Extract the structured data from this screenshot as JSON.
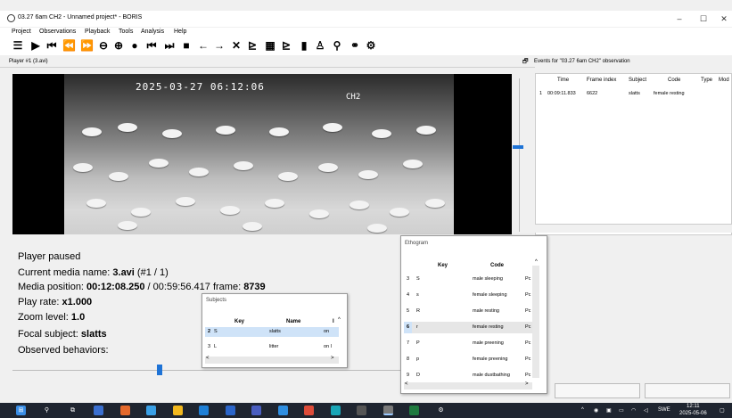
{
  "window": {
    "title": "03.27 6am CH2 - Unnamed project* - BORIS",
    "minimize": "–",
    "maximize": "☐",
    "close": "✕"
  },
  "menu": [
    "Project",
    "Observations",
    "Playback",
    "Tools",
    "Analysis",
    "Help"
  ],
  "toolbar_icons": [
    "list-icon",
    "play-icon",
    "step-back-icon",
    "rewind-icon",
    "fast-forward-icon",
    "minus-circle-icon",
    "plus-circle-icon",
    "record-icon",
    "skip-back-icon",
    "skip-forward-icon",
    "camera-icon",
    "arrow-left-icon",
    "arrow-right-icon",
    "close-icon",
    "bar-chart-icon",
    "grid-icon",
    "line-chart-icon",
    "histogram-icon",
    "person-icon",
    "search-icon",
    "binoculars-icon",
    "settings-icon"
  ],
  "player": {
    "header": "Player #1 (3.avi)",
    "video_timestamp": "2025-03-27 06:12:06",
    "video_camera": "CH2"
  },
  "events": {
    "pin": "🗗",
    "title": "Events for \"03.27 6am CH2\" observation",
    "columns": [
      "Time",
      "Frame index",
      "Subject",
      "Code",
      "Type",
      "Mod"
    ],
    "rows": [
      {
        "num": "1",
        "time": "00:09:11.833",
        "frame": "6622",
        "subject": "slatts",
        "code": "female resting",
        "type": "",
        "mod": ""
      }
    ]
  },
  "info": {
    "status": "Player paused",
    "media_name_label": "Current media name: ",
    "media_name_value": "3.avi",
    "media_name_suffix": " (#1 / 1)",
    "position_label": "Media position: ",
    "position_value": "00:12:08.250",
    "position_mid": " / 00:59:56.417 frame: ",
    "frame_value": "8739",
    "rate_label": "Play rate: ",
    "rate_value": "x1.000",
    "zoom_label": "Zoom level: ",
    "zoom_value": "1.0",
    "focal_label": "Focal subject: ",
    "focal_value": "slatts",
    "observed_label": "Observed behaviors:"
  },
  "subjects": {
    "title": "Subjects",
    "columns": [
      "Key",
      "Name",
      "I"
    ],
    "rows": [
      {
        "num": "2",
        "key": "S",
        "name": "slatts",
        "desc": "on"
      },
      {
        "num": "3",
        "key": "L",
        "name": "litter",
        "desc": "on l"
      }
    ]
  },
  "ethogram": {
    "title": "Ethogram",
    "columns": [
      "Key",
      "Code"
    ],
    "rows": [
      {
        "num": "3",
        "key": "S",
        "code": "male sleeping",
        "type": "Pc"
      },
      {
        "num": "4",
        "key": "s",
        "code": "female sleeping",
        "type": "Pc"
      },
      {
        "num": "5",
        "key": "R",
        "code": "male resting",
        "type": "Pc"
      },
      {
        "num": "6",
        "key": "r",
        "code": "female resting",
        "type": "Pc"
      },
      {
        "num": "7",
        "key": "P",
        "code": "male preening",
        "type": "Pc"
      },
      {
        "num": "8",
        "key": "p",
        "code": "female preening",
        "type": "Pc"
      },
      {
        "num": "9",
        "key": "D",
        "code": "male dustbathing",
        "type": "Pc"
      }
    ]
  },
  "taskbar": {
    "lang": "SWE",
    "time": "12:11",
    "date": "2025-05-06"
  },
  "colors": {
    "accent": "#1e73d6",
    "taskbar": "#1f2530"
  }
}
